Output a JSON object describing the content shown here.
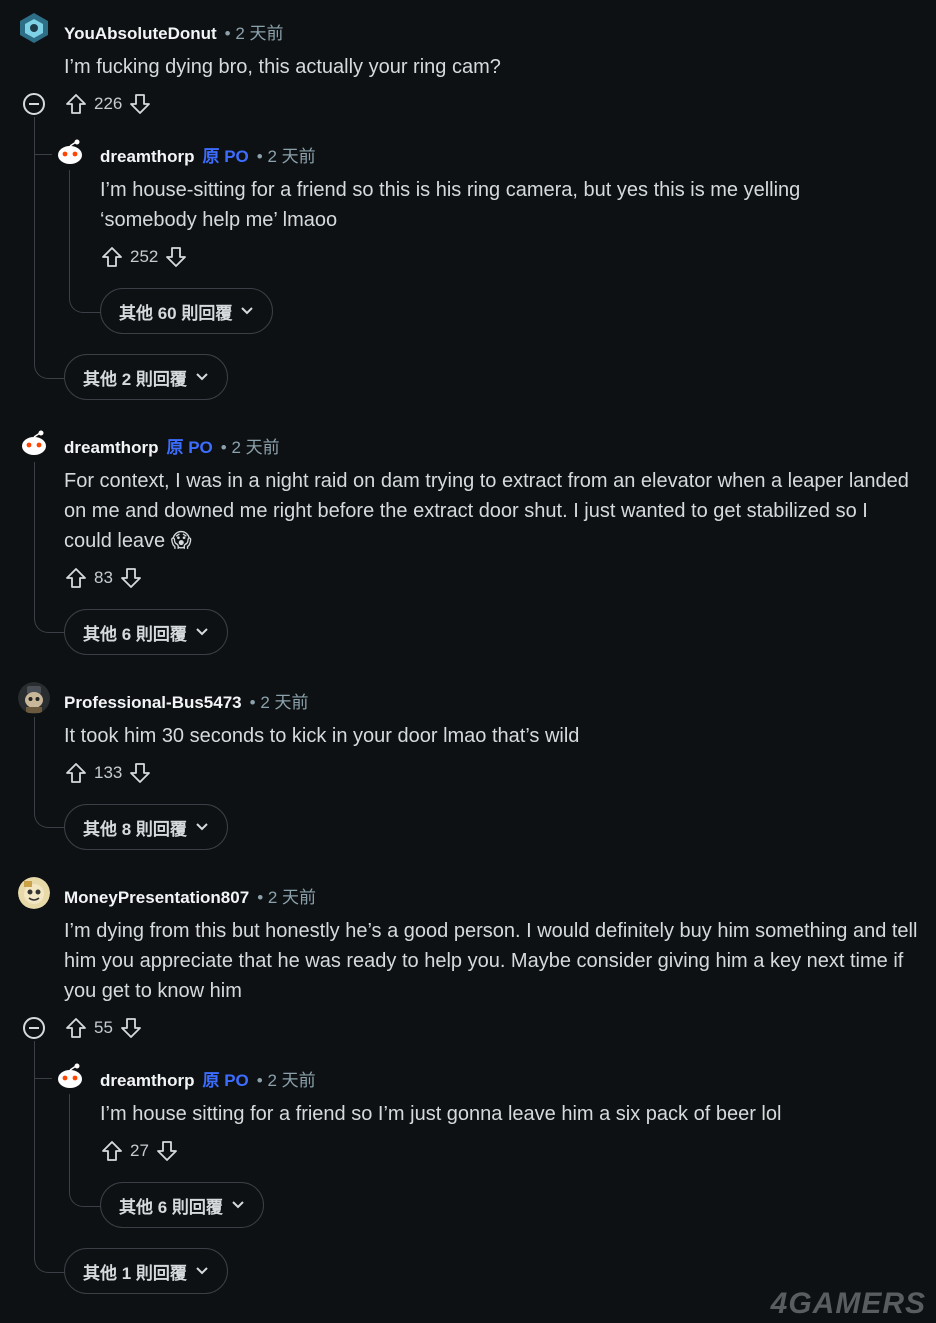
{
  "comments": [
    {
      "username": "YouAbsoluteDonut",
      "time": "• 2 天前",
      "text": "I’m fucking dying bro, this actually your ring cam?",
      "votes": "226",
      "more": "其他 2 則回覆",
      "reply": {
        "username": "dreamthorp",
        "op": "原 PO",
        "time": "• 2 天前",
        "text": "I’m house-sitting for a friend so this is his ring camera, but yes this is me yelling ‘somebody help me’ lmaoo",
        "votes": "252",
        "more": "其他 60 則回覆"
      }
    },
    {
      "username": "dreamthorp",
      "op": "原 PO",
      "time": "• 2 天前",
      "text": "For context, I was in a night raid on dam trying to extract from an elevator when a leaper landed on me and downed me right before the extract door shut. I just wanted to get stabilized so I could leave 😱",
      "votes": "83",
      "more": "其他 6 則回覆"
    },
    {
      "username": "Professional-Bus5473",
      "time": "• 2 天前",
      "text": "It took him 30 seconds to kick in your door lmao that’s wild",
      "votes": "133",
      "more": "其他 8 則回覆"
    },
    {
      "username": "MoneyPresentation807",
      "time": "• 2 天前",
      "text": "I’m dying from this but honestly he’s a good person. I would definitely buy him something and tell him you appreciate that he was ready to help you. Maybe consider giving him a key next time if you get to know him",
      "votes": "55",
      "more": "其他 1 則回覆",
      "reply": {
        "username": "dreamthorp",
        "op": "原 PO",
        "time": "• 2 天前",
        "text": "I’m house sitting for a friend so I’m just gonna leave him a six pack of beer lol",
        "votes": "27",
        "more": "其他 6 則回覆"
      }
    }
  ],
  "watermark": "4GAMERS",
  "icons": {
    "upvote": "arrow-up-icon",
    "downvote": "arrow-down-icon",
    "chevron": "chevron-down-icon",
    "collapse": "collapse-thread-icon"
  },
  "colors": {
    "background": "#0e1113",
    "op": "#3d6dff",
    "meta": "#8ba2ad",
    "thread_line": "#3a4046"
  }
}
